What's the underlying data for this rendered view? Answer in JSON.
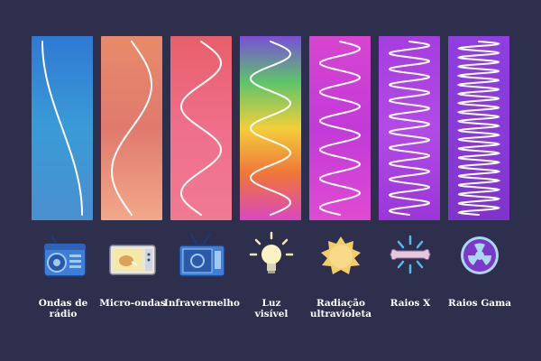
{
  "spectrum": [
    {
      "id": "radio",
      "label": "Ondas de\nrádio",
      "colors": [
        "#2f79d4",
        "#3a9bd6",
        "#4a8fd0"
      ],
      "cycles": 0.5,
      "icon": "radio-icon"
    },
    {
      "id": "microwave",
      "label": "Micro-ondas",
      "colors": [
        "#e88a6a",
        "#e07a6e",
        "#f2a88a"
      ],
      "cycles": 1,
      "icon": "microwave-oven-icon"
    },
    {
      "id": "infrared",
      "label": "Infravermelho",
      "colors": [
        "#e85f6b",
        "#ef6f8a",
        "#f07a92"
      ],
      "cycles": 2,
      "icon": "television-icon"
    },
    {
      "id": "visible",
      "label": "Luz\nvisível",
      "colors": [
        "#7a4fd8",
        "#5ec46a",
        "#f2cf3a",
        "#f0743a",
        "#d948c0"
      ],
      "cycles": 3.5,
      "icon": "light-bulb-icon"
    },
    {
      "id": "ultraviolet",
      "label": "Radiação\nultravioleta",
      "colors": [
        "#d845d0",
        "#c23ad8",
        "#e04ad2"
      ],
      "cycles": 6,
      "icon": "sun-icon"
    },
    {
      "id": "xray",
      "label": "Raios X",
      "colors": [
        "#a53ee0",
        "#b24ae6",
        "#9a36d8"
      ],
      "cycles": 11,
      "icon": "bone-xray-icon"
    },
    {
      "id": "gamma",
      "label": "Raios Gama",
      "colors": [
        "#8f3ee0",
        "#8a3ad8",
        "#7f34cc"
      ],
      "cycles": 19,
      "icon": "radiation-icon"
    }
  ]
}
